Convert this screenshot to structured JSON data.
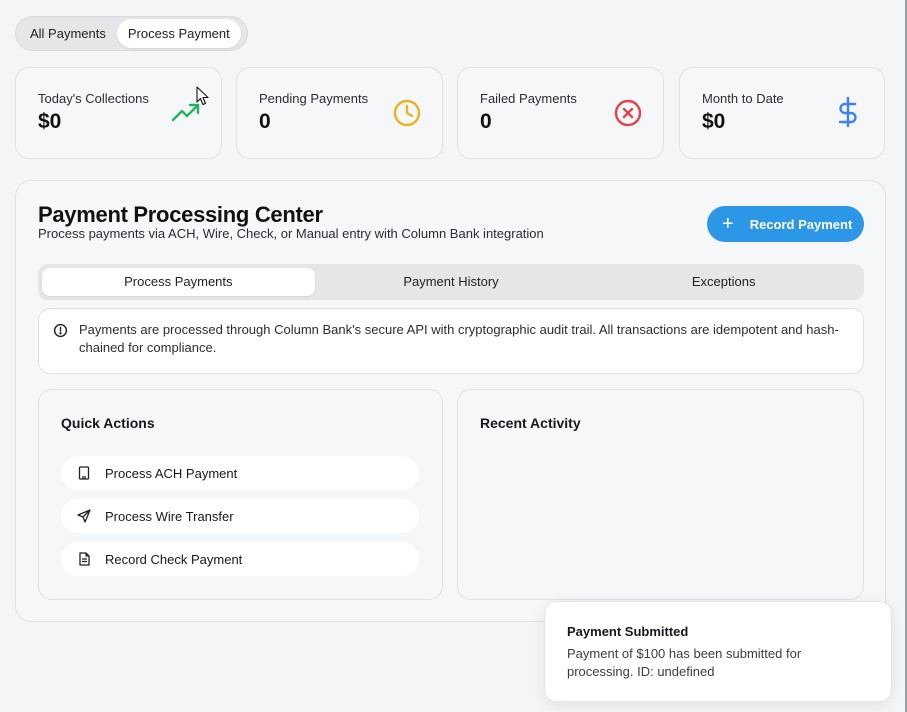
{
  "top_toggle": {
    "options": [
      "All Payments",
      "Process Payment"
    ],
    "active": "Process Payment"
  },
  "stats": [
    {
      "label": "Today's Collections",
      "value": "$0",
      "icon": "trending-up-icon",
      "color": "#22b35e"
    },
    {
      "label": "Pending Payments",
      "value": "0",
      "icon": "clock-icon",
      "color": "#e8b321"
    },
    {
      "label": "Failed Payments",
      "value": "0",
      "icon": "x-circle-icon",
      "color": "#e2434a"
    },
    {
      "label": "Month to Date",
      "value": "$0",
      "icon": "dollar-icon",
      "color": "#3b82f6"
    }
  ],
  "panel": {
    "title": "Payment Processing Center",
    "subtitle": "Process payments via ACH, Wire, Check, or Manual entry with Column Bank integration",
    "record_button": "Record Payment",
    "tabs": [
      "Process Payments",
      "Payment History",
      "Exceptions"
    ],
    "active_tab": "Process Payments",
    "notice": "Payments are processed through Column Bank's secure API with cryptographic audit trail. All transactions are idempotent and hash-chained for compliance."
  },
  "quick_actions": {
    "title": "Quick Actions",
    "items": [
      {
        "label": "Process ACH Payment",
        "icon": "building-icon"
      },
      {
        "label": "Process Wire Transfer",
        "icon": "send-icon"
      },
      {
        "label": "Record Check Payment",
        "icon": "file-text-icon"
      }
    ]
  },
  "recent_activity": {
    "title": "Recent Activity"
  },
  "toast": {
    "title": "Payment Submitted",
    "body": "Payment of $100 has been submitted for processing. ID: undefined"
  },
  "colors": {
    "accent": "#2b97e6"
  }
}
